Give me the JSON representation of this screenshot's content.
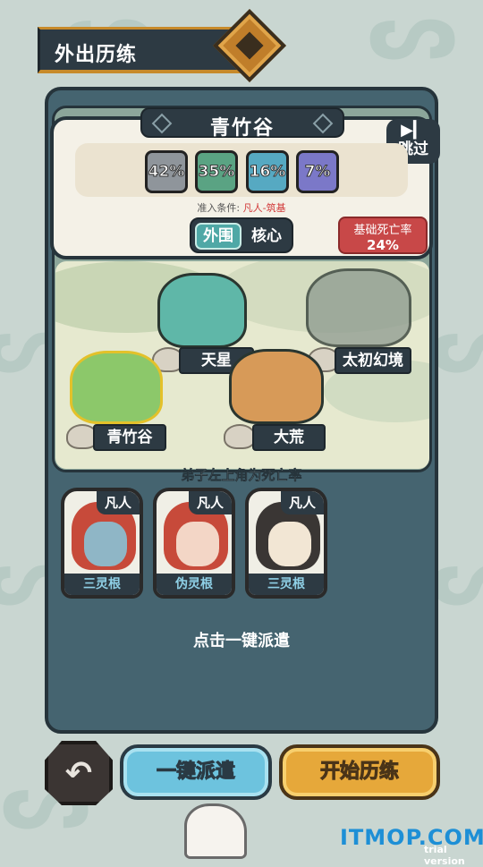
{
  "header": {
    "title": "外出历练"
  },
  "location": {
    "name": "青竹谷"
  },
  "skip": {
    "label": "跳过",
    "icon": "skip-forward-icon"
  },
  "rates": [
    {
      "value": "42%",
      "color": "#8f959b"
    },
    {
      "value": "35%",
      "color": "#5aa383"
    },
    {
      "value": "16%",
      "color": "#56a9c2"
    },
    {
      "value": "7%",
      "color": "#7b78c8"
    }
  ],
  "requirement": {
    "label": "准入条件: ",
    "value": "凡人-筑基"
  },
  "zone": {
    "outer": "外围",
    "core": "核心",
    "selected": "outer"
  },
  "death_rate": {
    "label": "基础死亡率",
    "value": "24%"
  },
  "map": {
    "locations": [
      {
        "name": "天星"
      },
      {
        "name": "太初幻境"
      },
      {
        "name": "青竹谷"
      },
      {
        "name": "大荒"
      }
    ]
  },
  "hint": "弟子左上角为死亡率",
  "disciples": [
    {
      "rank": "凡人",
      "root": "三灵根"
    },
    {
      "rank": "凡人",
      "root": "伪灵根"
    },
    {
      "rank": "凡人",
      "root": "三灵根"
    }
  ],
  "dispatch_hint": "点击一键派遣",
  "buttons": {
    "dispatch": "一键派遣",
    "start": "开始历练"
  },
  "watermark": {
    "site": "ITMOP.COM",
    "trial": "trial version"
  }
}
